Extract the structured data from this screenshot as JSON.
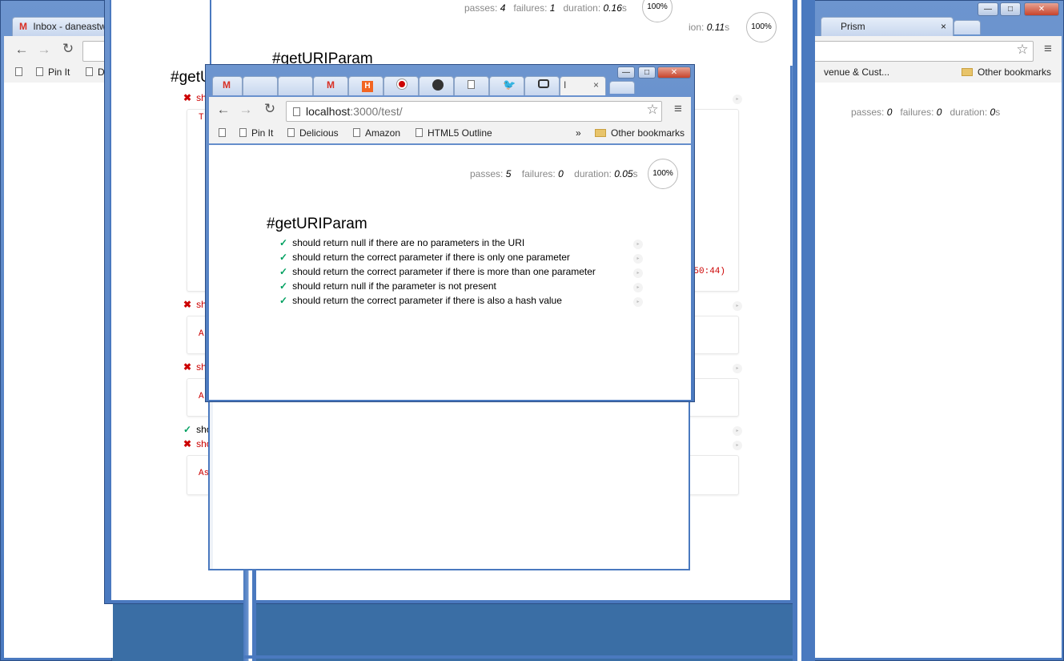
{
  "desktop": {
    "background": "#3a6ea5"
  },
  "right_window": {
    "tab_title": "Prism",
    "tab_close": "×",
    "bookmark_partial": "venue & Cust...",
    "other_bookmarks": "Other bookmarks",
    "stats": {
      "passes_label": "passes:",
      "passes": "0",
      "failures_label": "failures:",
      "failures": "0",
      "duration_label": "duration:",
      "duration": "0",
      "duration_unit": "s"
    }
  },
  "left_window": {
    "tab_title": "Inbox - daneastw",
    "bookmarks": [
      "Pin It",
      "D"
    ],
    "heading_partial": "#getU",
    "tests": [
      {
        "status": "fail",
        "text": "sh"
      },
      {
        "status": "fail",
        "text": "sh"
      },
      {
        "status": "fail",
        "text": "sh"
      },
      {
        "status": "pass",
        "text": "sho"
      },
      {
        "status": "fail",
        "text": "sho"
      }
    ],
    "error_snippets": [
      "T",
      "A",
      "A",
      "As"
    ],
    "trace_tail": "50:44)"
  },
  "middle_window": {
    "stats": {
      "passes_label": "passes:",
      "passes": "4",
      "failures_label": "failures:",
      "failures": "1",
      "duration_label": "duration:",
      "duration": "0.16",
      "duration_unit": "s"
    },
    "progress": "100%",
    "second_duration": "0.11",
    "second_duration_unit": "s",
    "second_duration_label": "ion:",
    "second_progress": "100%",
    "heading": "#getURIParam"
  },
  "front_window": {
    "address": {
      "host": "localhost",
      "path": ":3000/test/"
    },
    "bookmarks": [
      "Pin It",
      "Delicious",
      "Amazon",
      "HTML5 Outline"
    ],
    "more_bookmarks": "»",
    "other_bookmarks": "Other bookmarks",
    "active_tab_partial": "I",
    "tab_close": "×",
    "stats": {
      "passes_label": "passes:",
      "passes": "5",
      "failures_label": "failures:",
      "failures": "0",
      "duration_label": "duration:",
      "duration": "0.05",
      "duration_unit": "s"
    },
    "progress": "100%",
    "heading": "#getURIParam",
    "tests": [
      {
        "status": "pass",
        "mark": "✓",
        "text": "should return null if there are no parameters in the URI"
      },
      {
        "status": "pass",
        "mark": "✓",
        "text": "should return the correct parameter if there is only one parameter"
      },
      {
        "status": "pass",
        "mark": "✓",
        "text": "should return the correct parameter if there is more than one parameter"
      },
      {
        "status": "pass",
        "mark": "✓",
        "text": "should return null if the parameter is not present"
      },
      {
        "status": "pass",
        "mark": "✓",
        "text": "should return the correct parameter if there is also a hash value"
      }
    ],
    "tab_icons": [
      "gmail-icon",
      "blank-tab-icon",
      "blank-tab-icon",
      "gmail-icon",
      "hackernews-icon",
      "record-icon",
      "github-icon",
      "page-icon",
      "twitter-icon",
      "chat-icon"
    ],
    "colors": {
      "pass": "#00a060",
      "fail": "#cc0000",
      "gmail": "#d93025",
      "hn": "#f26522",
      "twitter": "#1da1f2"
    }
  },
  "symbols": {
    "fail_mark": "✖",
    "pass_mark": "✓",
    "run_dot": "▸"
  }
}
